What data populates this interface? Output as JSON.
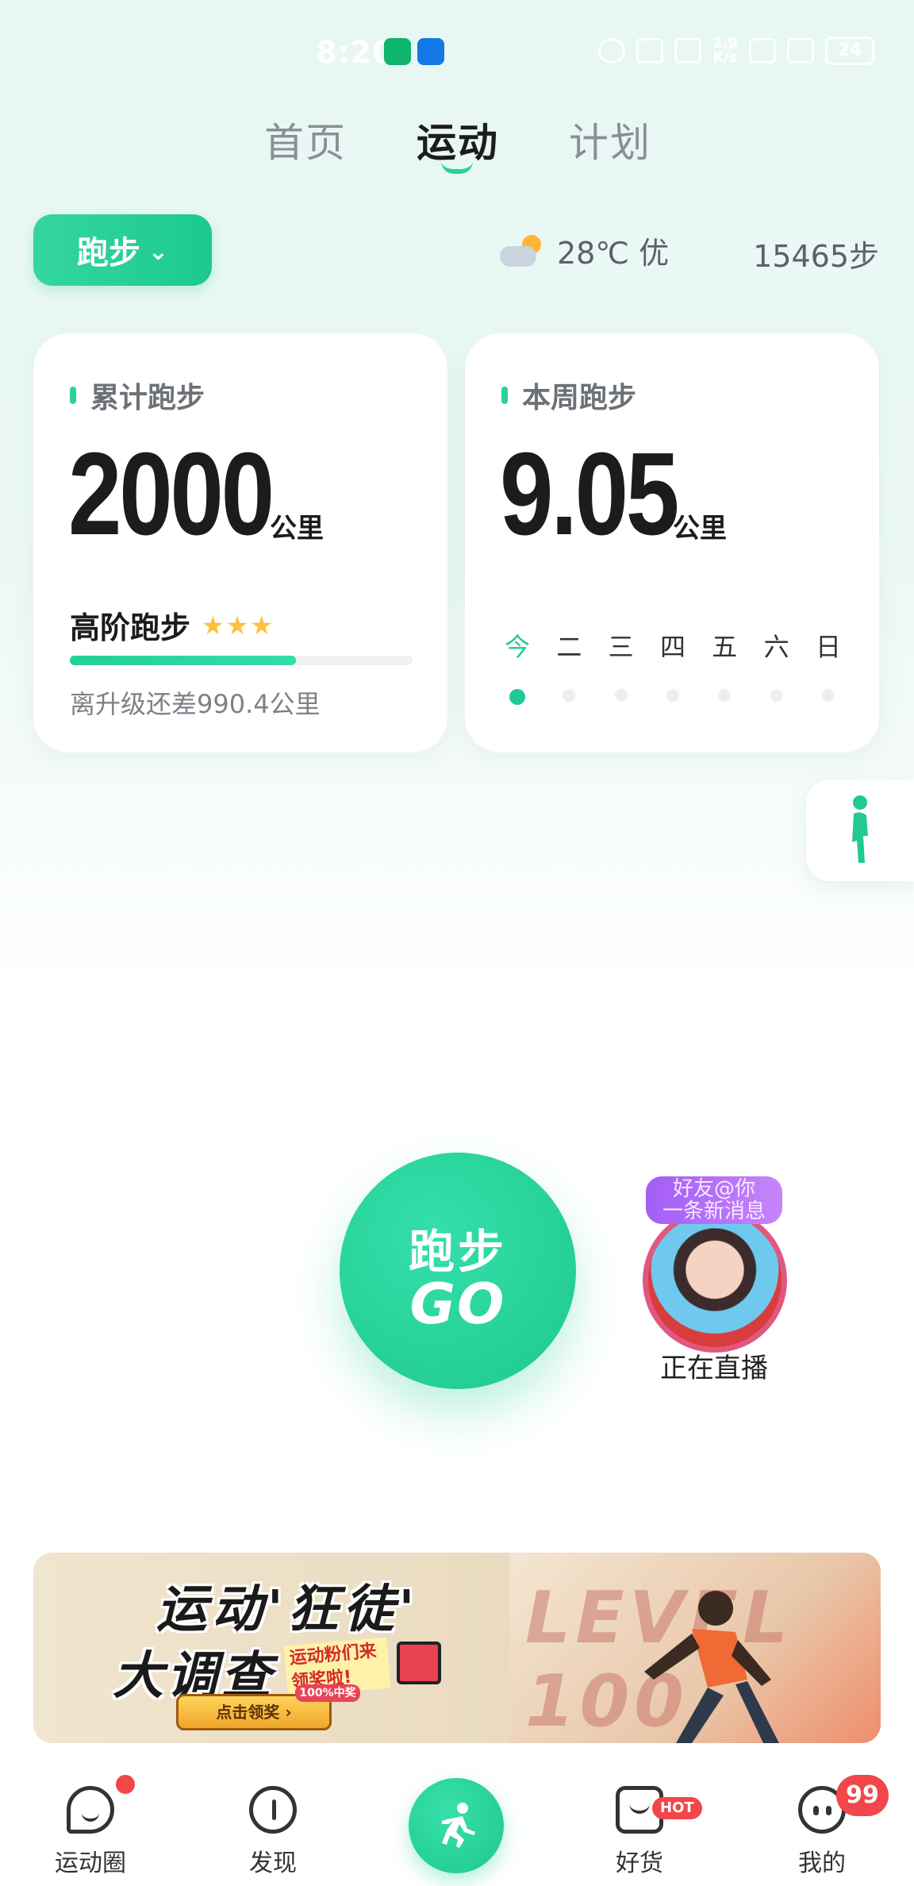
{
  "status_bar": {
    "time": "8:20",
    "net_speed": "2.9\nK/s",
    "battery": "24"
  },
  "tabs": [
    {
      "label": "首页"
    },
    {
      "label": "运动"
    },
    {
      "label": "计划"
    }
  ],
  "sport_selector": {
    "label": "跑步"
  },
  "weather": {
    "text": "28℃ 优",
    "icon": "cloud-sun-icon"
  },
  "steps": {
    "text": "15465步"
  },
  "card_total": {
    "title": "累计跑步",
    "value": "2000",
    "unit": "公里",
    "level": "高阶跑步",
    "stars": "★★★",
    "progress_fraction": 0.66,
    "remaining": "离升级还差990.4公里"
  },
  "card_week": {
    "title": "本周跑步",
    "value": "9.05",
    "unit": "公里",
    "days": [
      "今",
      "二",
      "三",
      "四",
      "五",
      "六",
      "日"
    ]
  },
  "go_button": {
    "line1": "跑步",
    "line2": "GO"
  },
  "live": {
    "message": "好友@你\n一条新消息",
    "label": "正在直播"
  },
  "banner": {
    "title1": "运动'狂徒'",
    "title2": "大调查",
    "subtitle": "运动粉们来领奖啦!",
    "button": "点击领奖 ›",
    "tag": "100%中奖",
    "right_text": "LEVEL 100"
  },
  "nav": {
    "items": [
      {
        "label": "运动圈"
      },
      {
        "label": "发现"
      },
      {
        "label": "好货"
      },
      {
        "label": "我的"
      }
    ],
    "hot_badge": "HOT",
    "count_badge": "99"
  },
  "colors": {
    "accent": "#22c995",
    "badge": "#f2464b",
    "star": "#ffbf3f"
  }
}
